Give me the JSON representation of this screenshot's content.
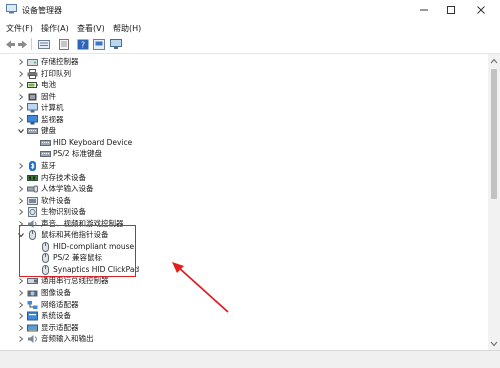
{
  "window": {
    "title": "设备管理器"
  },
  "menu": [
    "文件(F)",
    "操作(A)",
    "查看(V)",
    "帮助(H)"
  ],
  "toolbar": [
    "back-icon",
    "forward-icon",
    "device-list-icon",
    "properties-icon",
    "help-icon",
    "monitor-icon"
  ],
  "tree": [
    {
      "label": "存储控制器",
      "icon": "storage-controller-icon",
      "expanded": false,
      "child": false
    },
    {
      "label": "打印队列",
      "icon": "printer-icon",
      "expanded": false,
      "child": false
    },
    {
      "label": "电池",
      "icon": "battery-icon",
      "expanded": false,
      "child": false
    },
    {
      "label": "固件",
      "icon": "firmware-icon",
      "expanded": false,
      "child": false
    },
    {
      "label": "计算机",
      "icon": "computer-icon",
      "expanded": false,
      "child": false
    },
    {
      "label": "监视器",
      "icon": "monitor-icon",
      "expanded": false,
      "child": false
    },
    {
      "label": "键盘",
      "icon": "keyboard-icon",
      "expanded": true,
      "child": false
    },
    {
      "label": "HID Keyboard Device",
      "icon": "keyboard-icon",
      "child": true
    },
    {
      "label": "PS/2 标准键盘",
      "icon": "keyboard-icon",
      "child": true
    },
    {
      "label": "蓝牙",
      "icon": "bluetooth-icon",
      "expanded": false,
      "child": false
    },
    {
      "label": "内存技术设备",
      "icon": "memory-device-icon",
      "expanded": false,
      "child": false
    },
    {
      "label": "人体学输入设备",
      "icon": "hid-device-icon",
      "expanded": false,
      "child": false
    },
    {
      "label": "软件设备",
      "icon": "software-device-icon",
      "expanded": false,
      "child": false
    },
    {
      "label": "生物识别设备",
      "icon": "biometric-icon",
      "expanded": false,
      "child": false
    },
    {
      "label": "声音、视频和游戏控制器",
      "icon": "sound-icon",
      "expanded": false,
      "child": false
    },
    {
      "label": "鼠标和其他指针设备",
      "icon": "mouse-icon",
      "expanded": true,
      "child": false
    },
    {
      "label": "HID-compliant mouse",
      "icon": "mouse-icon",
      "child": true
    },
    {
      "label": "PS/2 兼容鼠标",
      "icon": "mouse-icon",
      "child": true
    },
    {
      "label": "Synaptics HID ClickPad",
      "icon": "mouse-icon",
      "child": true
    },
    {
      "label": "通用串行总线控制器",
      "icon": "usb-icon",
      "expanded": false,
      "child": false
    },
    {
      "label": "图像设备",
      "icon": "camera-icon",
      "expanded": false,
      "child": false
    },
    {
      "label": "网络适配器",
      "icon": "network-adapter-icon",
      "expanded": false,
      "child": false
    },
    {
      "label": "系统设备",
      "icon": "system-device-icon",
      "expanded": false,
      "child": false
    },
    {
      "label": "显示适配器",
      "icon": "display-adapter-icon",
      "expanded": false,
      "child": false
    },
    {
      "label": "音频输入和输出",
      "icon": "audio-io-icon",
      "expanded": false,
      "child": false
    }
  ],
  "annotation": {
    "color": "#e02020"
  }
}
